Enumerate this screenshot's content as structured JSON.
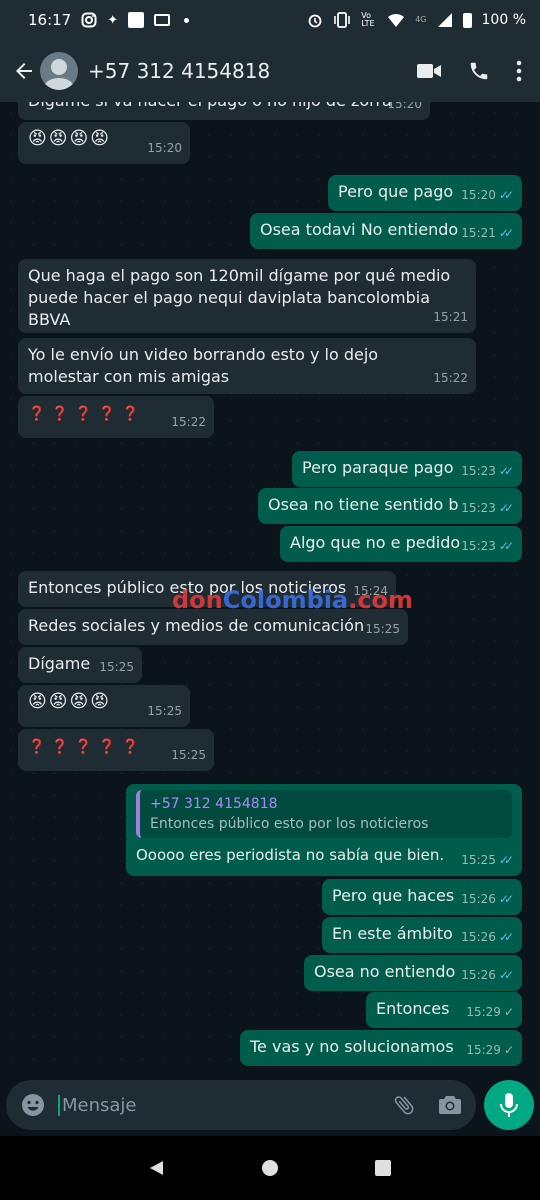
{
  "status_bar": {
    "time": "16:17",
    "battery": "100 %",
    "network": "4G",
    "volte": "Vo LTE",
    "left_icons": [
      "instagram-icon",
      "carrier-icon",
      "white-square-icon",
      "gallery-icon",
      "dot-icon"
    ],
    "right_icons": [
      "alarm-icon",
      "vibrate-icon",
      "volte-icon",
      "wifi-icon",
      "signal-icon",
      "battery-icon"
    ]
  },
  "header": {
    "contact": "+57 312 4154818",
    "icons": [
      "back-arrow-icon",
      "video-call-icon",
      "phone-icon",
      "more-vert-icon"
    ]
  },
  "messages": [
    {
      "dir": "in",
      "text": "Dígame si va hacer el pago o no hijo de zorra",
      "time": "15:20"
    },
    {
      "dir": "in",
      "text": "😡😡😡😡",
      "time": "15:20"
    },
    {
      "dir": "out",
      "text": "Pero que pago",
      "time": "15:20",
      "status": "read"
    },
    {
      "dir": "out",
      "text": "Osea todavi No entiendo",
      "time": "15:21",
      "status": "read"
    },
    {
      "dir": "in",
      "text": "Que haga el pago son 120mil dígame por qué medio puede hacer el pago nequi daviplata bancolombia BBVA",
      "time": "15:21"
    },
    {
      "dir": "in",
      "text": "Yo le envío un video borrando esto y lo dejo molestar con mis amigas",
      "time": "15:22"
    },
    {
      "dir": "in",
      "text": "❓❓❓❓❓",
      "time": "15:22"
    },
    {
      "dir": "out",
      "text": "Pero paraque pago",
      "time": "15:23",
      "status": "read"
    },
    {
      "dir": "out",
      "text": "Osea no tiene sentido b",
      "time": "15:23",
      "status": "read"
    },
    {
      "dir": "out",
      "text": "Algo que no e pedido",
      "time": "15:23",
      "status": "read"
    },
    {
      "dir": "in",
      "text": "Entonces público esto por los noticieros",
      "time": "15:24"
    },
    {
      "dir": "in",
      "text": "Redes sociales y medios de comunicación",
      "time": "15:25"
    },
    {
      "dir": "in",
      "text": "Dígame",
      "time": "15:25"
    },
    {
      "dir": "in",
      "text": "😡😡😡😡",
      "time": "15:25"
    },
    {
      "dir": "in",
      "text": "❓❓❓❓❓",
      "time": "15:25"
    },
    {
      "dir": "out",
      "text": "Ooooo eres periodista no sabía que bien.",
      "time": "15:25",
      "status": "read",
      "quote": {
        "author": "+57 312 4154818",
        "text": "Entonces público esto por los noticieros"
      }
    },
    {
      "dir": "out",
      "text": "Pero que haces",
      "time": "15:26",
      "status": "read"
    },
    {
      "dir": "out",
      "text": "En este ámbito",
      "time": "15:26",
      "status": "read"
    },
    {
      "dir": "out",
      "text": "Osea no entiendo",
      "time": "15:26",
      "status": "read"
    },
    {
      "dir": "out",
      "text": "Entonces",
      "time": "15:29",
      "status": "sent"
    },
    {
      "dir": "out",
      "text": "Te vas y no solucionamos",
      "time": "15:29",
      "status": "sent"
    }
  ],
  "watermark": {
    "part1": "don",
    "part2": "Colombia",
    "part3": ".com"
  },
  "composer": {
    "placeholder": "Mensaje",
    "icons": [
      "emoji-icon",
      "attach-icon",
      "camera-icon",
      "mic-icon"
    ]
  },
  "nav": {
    "icons": [
      "back-triangle-icon",
      "home-circle-icon",
      "recents-square-icon"
    ]
  },
  "colors": {
    "bg": "#0b141a",
    "bar": "#1f2c34",
    "incoming": "#202c33",
    "outgoing": "#005c4b",
    "accent": "#00a884",
    "read_tick": "#53bdeb",
    "quote_author": "#a78bfa"
  }
}
